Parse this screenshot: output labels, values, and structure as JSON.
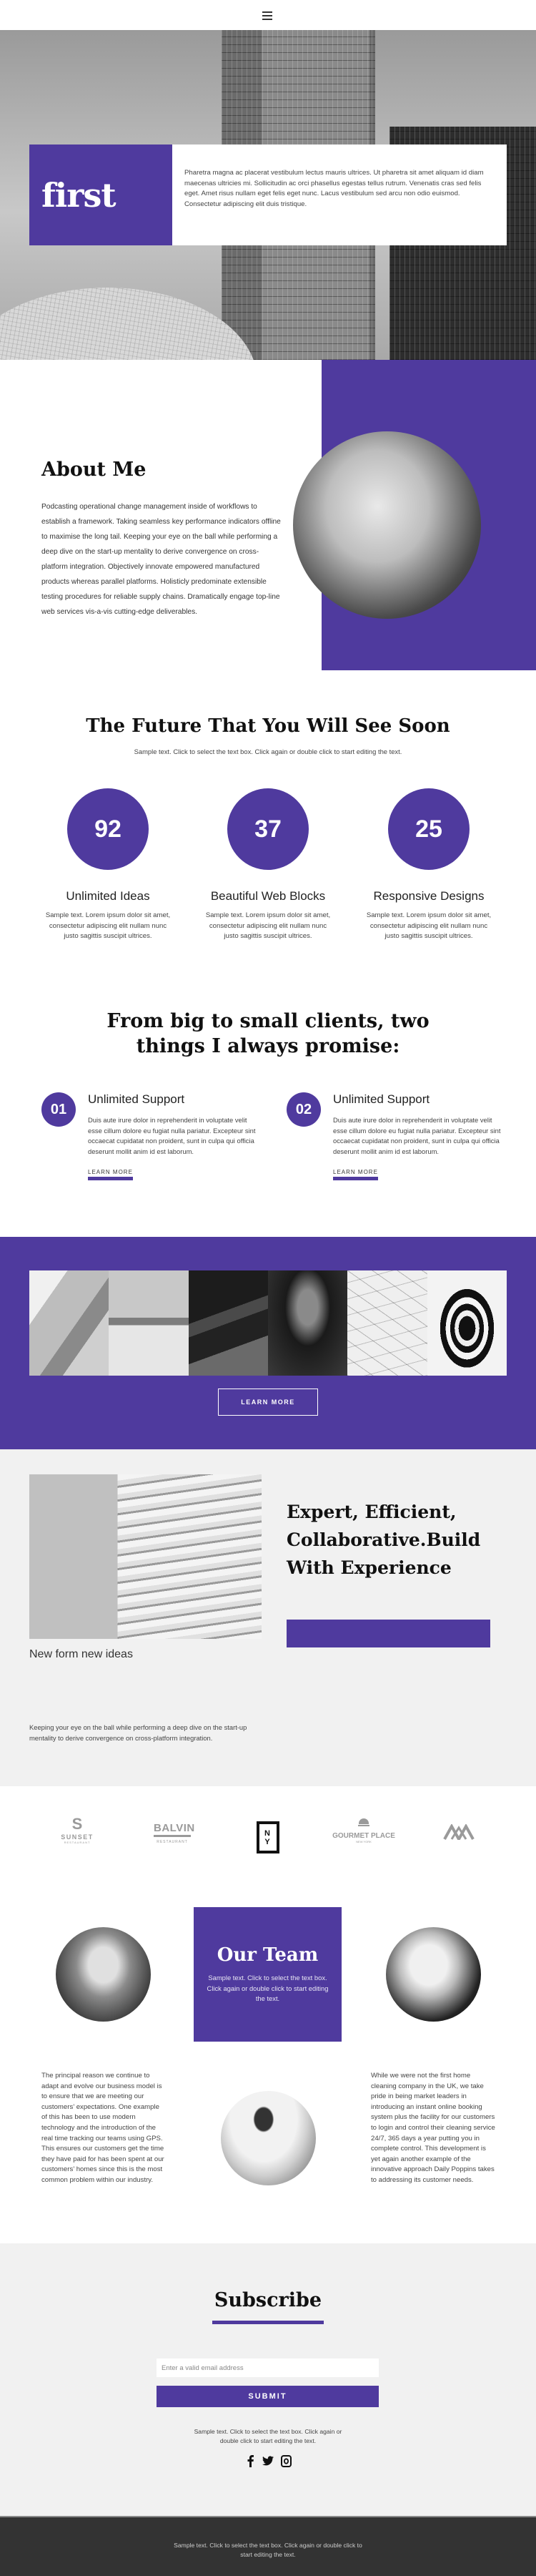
{
  "colors": {
    "accent": "#4f3a9e",
    "footer_bg": "#333333",
    "section_grey": "#f1f1f1"
  },
  "nav": {
    "menu_icon": "hamburger-icon"
  },
  "hero": {
    "brand": "first",
    "text": "Pharetra magna ac placerat vestibulum lectus mauris ultrices. Ut pharetra sit amet aliquam id diam maecenas ultricies mi. Sollicitudin ac orci phasellus egestas tellus rutrum. Venenatis cras sed felis eget. Amet risus nullam eget felis eget nunc. Lacus vestibulum sed arcu non odio euismod. Consectetur adipiscing elit duis tristique."
  },
  "about": {
    "title": "About Me",
    "text": "Podcasting operational change management inside of workflows to establish a framework. Taking seamless key performance indicators offline to maximise the long tail. Keeping your eye on the ball while performing a deep dive on the start-up mentality to derive convergence on cross-platform integration. Objectively innovate empowered manufactured products whereas parallel platforms. Holisticly predominate extensible testing procedures for reliable supply chains. Dramatically engage top-line web services vis-a-vis cutting-edge deliverables."
  },
  "future": {
    "title": "The Future That You Will See Soon",
    "subtitle": "Sample text. Click to select the text box. Click again or double click to start editing the text.",
    "stats": [
      {
        "value": "92",
        "title": "Unlimited Ideas",
        "text": "Sample text. Lorem ipsum dolor sit amet, consectetur adipiscing elit nullam nunc justo sagittis suscipit ultrices."
      },
      {
        "value": "37",
        "title": "Beautiful Web Blocks",
        "text": "Sample text. Lorem ipsum dolor sit amet, consectetur adipiscing elit nullam nunc justo sagittis suscipit ultrices."
      },
      {
        "value": "25",
        "title": "Responsive Designs",
        "text": "Sample text. Lorem ipsum dolor sit amet, consectetur adipiscing elit nullam nunc justo sagittis suscipit ultrices."
      }
    ]
  },
  "promise": {
    "title_line1": "From big to small clients, two",
    "title_line2": "things I always promise:",
    "items": [
      {
        "number": "01",
        "title": "Unlimited Support",
        "text": "Duis aute irure dolor in reprehenderit in voluptate velit esse cillum dolore eu fugiat nulla pariatur. Excepteur sint occaecat cupidatat non proident, sunt in culpa qui officia deserunt mollit anim id est laborum.",
        "link": "LEARN MORE"
      },
      {
        "number": "02",
        "title": "Unlimited Support",
        "text": "Duis aute irure dolor in reprehenderit in voluptate velit esse cillum dolore eu fugiat nulla pariatur. Excepteur sint occaecat cupidatat non proident, sunt in culpa qui officia deserunt mollit anim id est laborum.",
        "link": "LEARN MORE"
      }
    ]
  },
  "gallery": {
    "images": [
      "abstract-architecture",
      "tulips-laptop",
      "dark-building-angle",
      "smiling-woman-portrait",
      "white-lattice-ceiling",
      "spiral-staircase"
    ],
    "button": "LEARN MORE"
  },
  "expert": {
    "title": "Expert, Efficient, Collaborative.Build With Experience",
    "caption": "New form new ideas",
    "text": "Keeping your eye on the ball while performing a deep dive on the start-up mentality to derive convergence on cross-platform integration."
  },
  "logos": [
    {
      "mark": "S",
      "name": "SUNSET",
      "sub": "RESTAURANT"
    },
    {
      "name": "BALVIN",
      "sub": "RESTAURANT"
    },
    {
      "name": "N Y"
    },
    {
      "name": "GOURMET PLACE",
      "sub": "NEW YORK"
    },
    {
      "name": "mountains-logo"
    }
  ],
  "team": {
    "title": "Our Team",
    "subtitle": "Sample text. Click to select the text box. Click again or double click to start editing the text.",
    "left_text": "The principal reason we continue to adapt and evolve our business model is to ensure that we are meeting our customers’ expectations. One example of this has been to use modern technology and the introduction of the real time tracking our teams using GPS. This ensures our customers get the time they have paid for has been spent at our customers’ homes since this is the most common problem within our industry.",
    "right_text": "While we were not the first home cleaning company in the UK, we take pride in being market leaders in introducing an instant online booking system plus the facility for our customers to login and control their cleaning service 24/7, 365 days a year putting you in complete control. This development is yet again another example of the innovative approach Daily Poppins takes to addressing its customer needs."
  },
  "subscribe": {
    "title": "Subscribe",
    "email_placeholder": "Enter a valid email address",
    "email_value": "",
    "submit": "SUBMIT",
    "note": "Sample text. Click to select the text box. Click again or double click to start editing the text.",
    "socials": [
      {
        "name": "facebook",
        "glyph": "f"
      },
      {
        "name": "twitter",
        "glyph": "🐦"
      },
      {
        "name": "instagram",
        "glyph": "◎"
      }
    ]
  },
  "footer": {
    "text": "Sample text. Click to select the text box. Click again or double click to start editing the text."
  }
}
